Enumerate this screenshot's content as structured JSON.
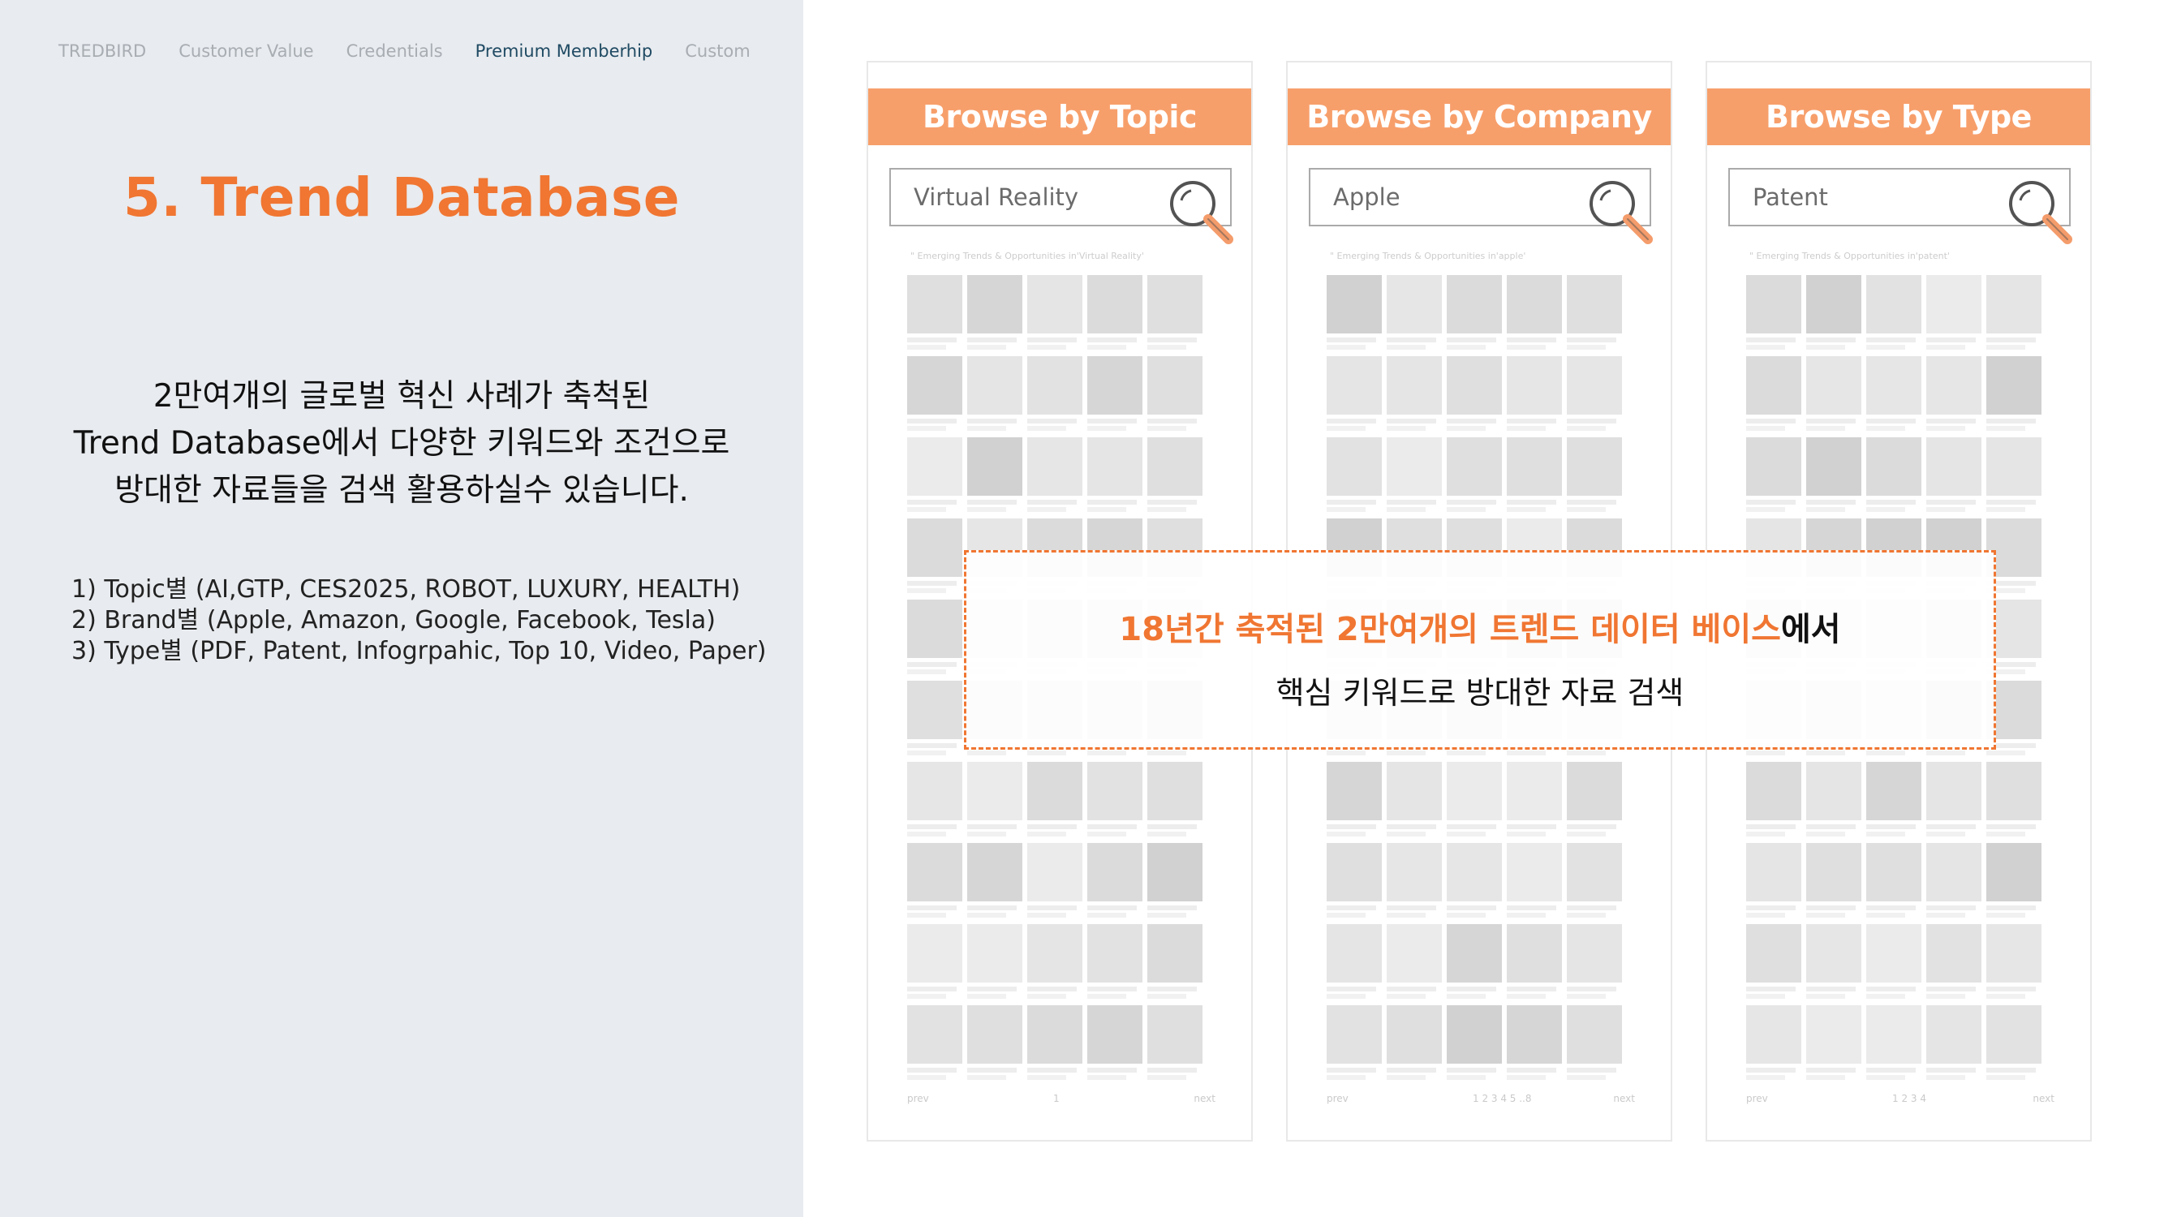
{
  "nav": {
    "items": [
      "TREDBIRD",
      "Customer Value",
      "Credentials",
      "Premium Memberhip",
      "Custom"
    ],
    "active_index": 3
  },
  "title": "5. Trend Database",
  "intro": {
    "line1": "2만여개의 글로벌 혁신 사례가 축척된",
    "line2": "Trend Database에서 다양한 키워드와 조건으로",
    "line3": "방대한 자료들을 검색 활용하실수 있습니다."
  },
  "features": [
    "1) Topic별 (AI,GTP, CES2025, ROBOT, LUXURY, HEALTH)",
    "2) Brand별 (Apple, Amazon, Google, Facebook, Tesla)",
    "3) Type별 (PDF, Patent, Infogrpahic, Top 10, Video, Paper)"
  ],
  "cards": [
    {
      "header": "Browse by Topic",
      "search_value": "Virtual Reality",
      "result_label": "\" Emerging Trends & Opportunities in'Virtual Reality' ",
      "pager": {
        "prev": "prev",
        "pages": "1",
        "next": "next"
      }
    },
    {
      "header": "Browse by Company",
      "search_value": "Apple",
      "result_label": "\" Emerging Trends & Opportunities in'apple' ",
      "pager": {
        "prev": "prev",
        "pages": "1 2 3 4 5 ..8",
        "next": "next"
      }
    },
    {
      "header": "Browse by Type",
      "search_value": "Patent",
      "result_label": "\" Emerging Trends & Opportunities in'patent' ",
      "pager": {
        "prev": "prev",
        "pages": "1 2 3 4",
        "next": "next"
      }
    }
  ],
  "callout": {
    "highlight": "18년간 축적된 2만여개의 트렌드 데이터 베이스",
    "suffix": "에서",
    "line2": "핵심 키워드로 방대한 자료 검색"
  },
  "colors": {
    "accent": "#f07632",
    "header_bg": "#f47a33",
    "left_panel_bg": "#e8ebef",
    "nav_active": "#1f4a63"
  }
}
